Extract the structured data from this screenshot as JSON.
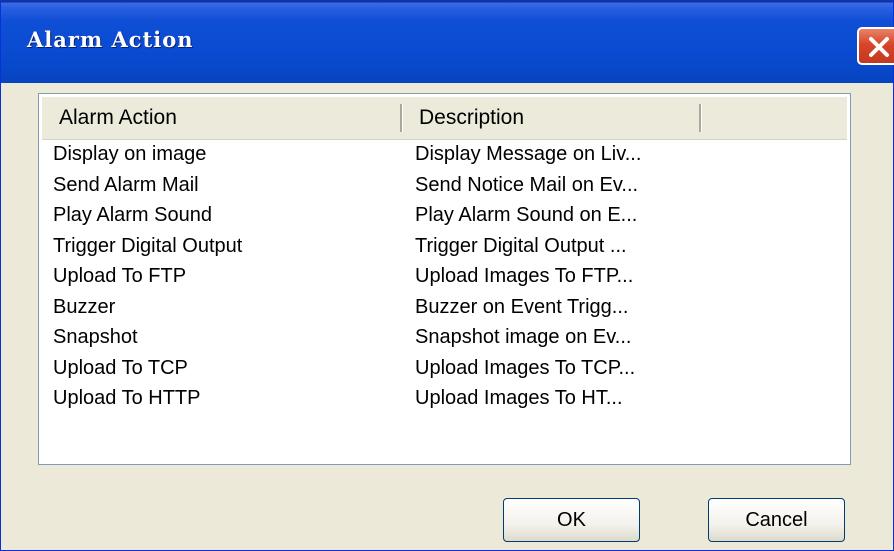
{
  "window": {
    "title": "Alarm Action"
  },
  "list": {
    "columns": [
      "Alarm Action",
      "Description"
    ],
    "rows": [
      {
        "action": "Display on image",
        "description": "Display Message on Liv..."
      },
      {
        "action": "Send Alarm Mail",
        "description": "Send Notice Mail on Ev..."
      },
      {
        "action": "Play Alarm Sound",
        "description": "Play Alarm Sound on E..."
      },
      {
        "action": "Trigger Digital Output",
        "description": "Trigger Digital Output ..."
      },
      {
        "action": "Upload To FTP",
        "description": "Upload Images To FTP..."
      },
      {
        "action": "Buzzer",
        "description": "Buzzer on Event Trigg..."
      },
      {
        "action": "Snapshot",
        "description": "Snapshot image on Ev..."
      },
      {
        "action": "Upload To TCP",
        "description": "Upload Images To TCP..."
      },
      {
        "action": "Upload To HTTP",
        "description": "Upload Images To HT..."
      }
    ]
  },
  "buttons": {
    "ok": "OK",
    "cancel": "Cancel"
  },
  "colors": {
    "titlebar": "#0a4bd2",
    "close": "#d8452a",
    "dialog_bg": "#ece9d8"
  }
}
